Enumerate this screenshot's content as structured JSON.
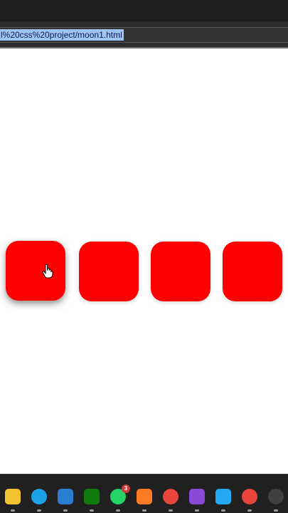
{
  "browser": {
    "url_text": "l%20css%20project/moon1.html"
  },
  "page": {
    "boxes": [
      {
        "color": "#ff0000",
        "state": "hovered"
      },
      {
        "color": "#ff0000",
        "state": "normal"
      },
      {
        "color": "#ff0000",
        "state": "normal"
      },
      {
        "color": "#ff0000",
        "state": "normal"
      }
    ]
  },
  "taskbar": {
    "icons": [
      {
        "name": "file-explorer-icon",
        "color": "#f2c230"
      },
      {
        "name": "edge-icon",
        "color": "#1aa1e8"
      },
      {
        "name": "store-icon",
        "color": "#2b7cd3"
      },
      {
        "name": "xbox-icon",
        "color": "#107c10"
      },
      {
        "name": "whatsapp-icon",
        "color": "#25d366",
        "badge": "3"
      },
      {
        "name": "xampp-icon",
        "color": "#fb7a24"
      },
      {
        "name": "chrome-icon",
        "color": "#e8453c"
      },
      {
        "name": "app-icon",
        "color": "#8a49d6"
      },
      {
        "name": "vscode-icon",
        "color": "#23a9f2"
      },
      {
        "name": "chrome-profile-icon",
        "color": "#e8453c"
      },
      {
        "name": "obs-icon",
        "color": "#404040"
      }
    ]
  }
}
